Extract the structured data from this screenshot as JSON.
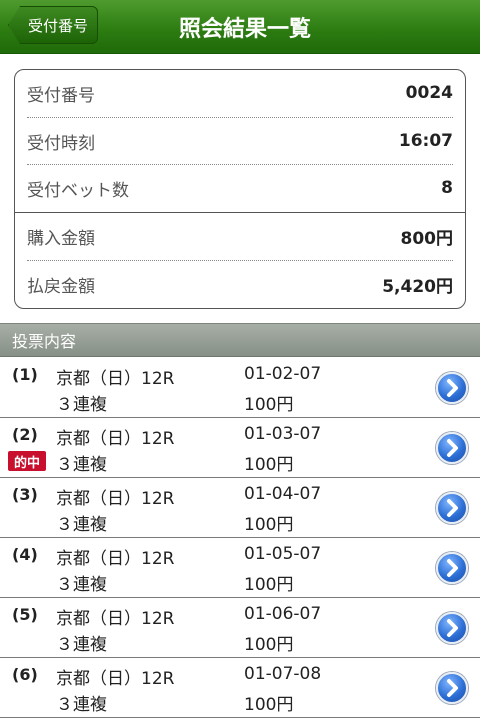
{
  "header": {
    "back_label": "受付番号",
    "title": "照会結果一覧"
  },
  "summary": {
    "rows": [
      {
        "label": "受付番号",
        "value": "0024"
      },
      {
        "label": "受付時刻",
        "value": "16:07"
      },
      {
        "label": "受付ベット数",
        "value": "8"
      },
      {
        "label": "購入金額",
        "value": "800円"
      },
      {
        "label": "払戻金額",
        "value": "5,420円"
      }
    ]
  },
  "section": {
    "title": "投票内容"
  },
  "bets": [
    {
      "num": "(1)",
      "race": "京都（日）12R",
      "type": "３連複",
      "combo": "01-02-07",
      "amount": "100円",
      "hit": ""
    },
    {
      "num": "(2)",
      "race": "京都（日）12R",
      "type": "３連複",
      "combo": "01-03-07",
      "amount": "100円",
      "hit": "的中"
    },
    {
      "num": "(3)",
      "race": "京都（日）12R",
      "type": "３連複",
      "combo": "01-04-07",
      "amount": "100円",
      "hit": ""
    },
    {
      "num": "(4)",
      "race": "京都（日）12R",
      "type": "３連複",
      "combo": "01-05-07",
      "amount": "100円",
      "hit": ""
    },
    {
      "num": "(5)",
      "race": "京都（日）12R",
      "type": "３連複",
      "combo": "01-06-07",
      "amount": "100円",
      "hit": ""
    },
    {
      "num": "(6)",
      "race": "京都（日）12R",
      "type": "３連複",
      "combo": "01-07-08",
      "amount": "100円",
      "hit": ""
    }
  ],
  "icons": {
    "detail": "chevron-right-icon"
  },
  "colors": {
    "header_green": "#2d7d12",
    "hit_red": "#c8102e",
    "detail_blue": "#2d6fd6",
    "section_gray": "#959d95"
  }
}
